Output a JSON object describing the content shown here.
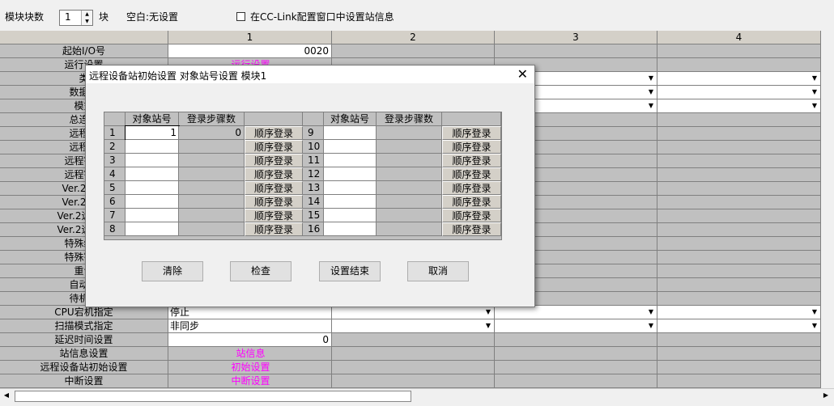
{
  "toolbar": {
    "module_count_label": "模块块数",
    "module_count_value": "1",
    "module_unit": "块",
    "blank_label": "空白:无设置",
    "cclink_checkbox_label": "在CC-Link配置窗口中设置站信息"
  },
  "grid": {
    "columns": [
      "1",
      "2",
      "3",
      "4"
    ],
    "rows": [
      {
        "label": "起始I/O号",
        "col1": "0020",
        "col1_align": "right",
        "col1_type": "white"
      },
      {
        "label": "运行设置",
        "col1": "运行设置",
        "col1_type": "pink"
      },
      {
        "label": "类",
        "col1": "",
        "col1_type": "white",
        "dropdowns": true
      },
      {
        "label": "数据链",
        "col1": "",
        "col1_type": "white",
        "dropdowns": true
      },
      {
        "label": "模式",
        "col1": "",
        "col1_type": "white",
        "dropdowns": true
      },
      {
        "label": "总连接",
        "col1": "",
        "col1_type": "white"
      },
      {
        "label": "远程输",
        "col1": "",
        "col1_type": "white"
      },
      {
        "label": "远程输",
        "col1": "",
        "col1_type": "white"
      },
      {
        "label": "远程寄存",
        "col1": "",
        "col1_type": "white"
      },
      {
        "label": "远程寄存",
        "col1": "",
        "col1_type": "white"
      },
      {
        "label": "Ver.2远程",
        "col1": "",
        "col1_type": "white"
      },
      {
        "label": "Ver.2远程",
        "col1": "",
        "col1_type": "white"
      },
      {
        "label": "Ver.2远程寄",
        "col1": "",
        "col1_type": "white"
      },
      {
        "label": "Ver.2远程寄",
        "col1": "",
        "col1_type": "white"
      },
      {
        "label": "特殊继电",
        "col1": "",
        "col1_type": "white"
      },
      {
        "label": "特殊寄存",
        "col1": "",
        "col1_type": "white"
      },
      {
        "label": "重试",
        "col1": "",
        "col1_type": "white"
      },
      {
        "label": "自动恢",
        "col1": "",
        "col1_type": "white"
      },
      {
        "label": "待机主",
        "col1": "",
        "col1_type": "white"
      },
      {
        "label": "CPU宕机指定",
        "col1": "停止",
        "col1_type": "white",
        "dropdowns": true
      },
      {
        "label": "扫描模式指定",
        "col1": "非同步",
        "col1_type": "white",
        "dropdowns": true
      },
      {
        "label": "延迟时间设置",
        "col1": "0",
        "col1_align": "right",
        "col1_type": "white"
      },
      {
        "label": "站信息设置",
        "col1": "站信息",
        "col1_type": "pink"
      },
      {
        "label": "远程设备站初始设置",
        "col1": "初始设置",
        "col1_type": "pink"
      },
      {
        "label": "中断设置",
        "col1": "中断设置",
        "col1_type": "pink"
      }
    ]
  },
  "dialog": {
    "title": "远程设备站初始设置 对象站号设置  模块1",
    "close_glyph": "✕",
    "headers": {
      "station": "对象站号",
      "steps": "登录步骤数"
    },
    "left_rows": [
      {
        "no": "1",
        "station": "1",
        "steps": "0",
        "btn": "顺序登录"
      },
      {
        "no": "2",
        "station": "",
        "steps": "",
        "btn": "顺序登录"
      },
      {
        "no": "3",
        "station": "",
        "steps": "",
        "btn": "顺序登录"
      },
      {
        "no": "4",
        "station": "",
        "steps": "",
        "btn": "顺序登录"
      },
      {
        "no": "5",
        "station": "",
        "steps": "",
        "btn": "顺序登录"
      },
      {
        "no": "6",
        "station": "",
        "steps": "",
        "btn": "顺序登录"
      },
      {
        "no": "7",
        "station": "",
        "steps": "",
        "btn": "顺序登录"
      },
      {
        "no": "8",
        "station": "",
        "steps": "",
        "btn": "顺序登录"
      }
    ],
    "right_rows": [
      {
        "no": "9",
        "station": "",
        "steps": "",
        "btn": "顺序登录"
      },
      {
        "no": "10",
        "station": "",
        "steps": "",
        "btn": "顺序登录"
      },
      {
        "no": "11",
        "station": "",
        "steps": "",
        "btn": "顺序登录"
      },
      {
        "no": "12",
        "station": "",
        "steps": "",
        "btn": "顺序登录"
      },
      {
        "no": "13",
        "station": "",
        "steps": "",
        "btn": "顺序登录"
      },
      {
        "no": "14",
        "station": "",
        "steps": "",
        "btn": "顺序登录"
      },
      {
        "no": "15",
        "station": "",
        "steps": "",
        "btn": "顺序登录"
      },
      {
        "no": "16",
        "station": "",
        "steps": "",
        "btn": "顺序登录"
      }
    ],
    "buttons": {
      "clear": "清除",
      "check": "检查",
      "finish": "设置结束",
      "cancel": "取消"
    }
  },
  "icons": {
    "dropdown": "chevron-down-icon",
    "close": "close-icon",
    "scroll_left": "arrow-left-icon",
    "scroll_right": "arrow-right-icon"
  }
}
